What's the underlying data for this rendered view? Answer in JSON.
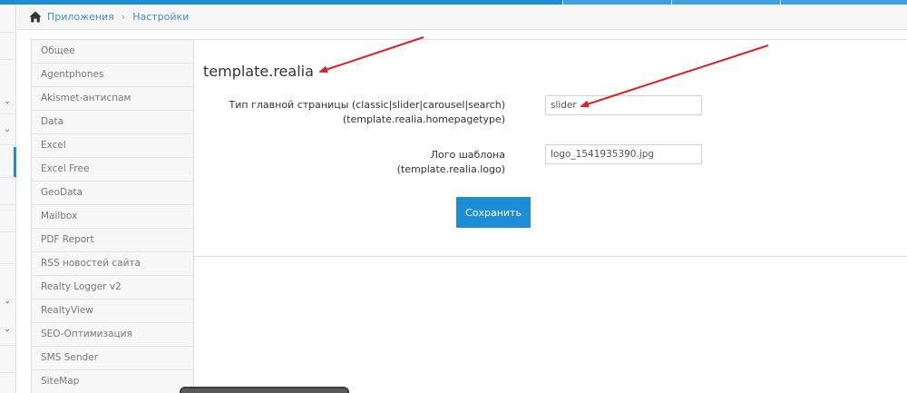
{
  "breadcrumb": {
    "home_icon": "home-icon",
    "items": [
      "Приложения",
      "Настройки"
    ],
    "separator": "›"
  },
  "settings_list": {
    "items": [
      "Общее",
      "Agentphones",
      "Akismet-антиспам",
      "Data",
      "Excel",
      "Excel Free",
      "GeoData",
      "Mailbox",
      "PDF Report",
      "RSS новостей сайта",
      "Realty Logger v2",
      "RealtyView",
      "SEO-Оптимизация",
      "SMS Sender",
      "SiteMap"
    ]
  },
  "main": {
    "title": "template.realia",
    "fields": [
      {
        "label": "Тип главной страницы (classic|slider|carousel|search)",
        "key": "(template.realia.homepagetype)",
        "value": "slider"
      },
      {
        "label": "Лого шаблона",
        "key": "(template.realia.logo)",
        "value": "logo_1541935390.jpg"
      }
    ],
    "save_label": "Сохранить"
  },
  "leftnav": {
    "icons": [
      "chevron-down-icon",
      "chevron-down-icon",
      "chevron-down-icon",
      "chevron-down-icon"
    ]
  },
  "colors": {
    "accent": "#1f8dd6",
    "annotation_arrow": "#d9222a",
    "link": "#4a8bc2"
  }
}
